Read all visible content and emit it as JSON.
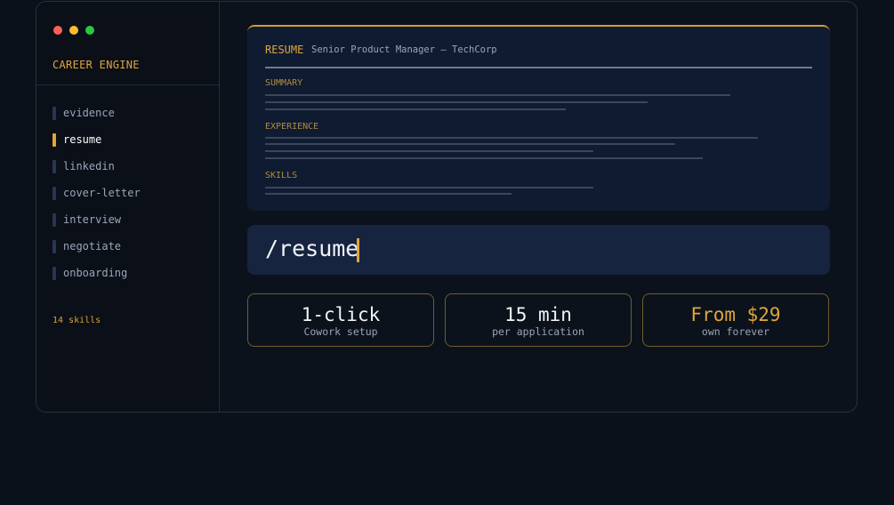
{
  "sidebar": {
    "brand": "CAREER ENGINE",
    "items": [
      {
        "label": "evidence",
        "active": false
      },
      {
        "label": "resume",
        "active": true
      },
      {
        "label": "linkedin",
        "active": false
      },
      {
        "label": "cover-letter",
        "active": false
      },
      {
        "label": "interview",
        "active": false
      },
      {
        "label": "negotiate",
        "active": false
      },
      {
        "label": "onboarding",
        "active": false
      }
    ],
    "skill_count": "14 skills"
  },
  "window_controls": {
    "close_color": "#ff5f57",
    "minimize_color": "#febc2e",
    "maximize_color": "#28c840"
  },
  "resume": {
    "title": "RESUME",
    "subtitle": "Senior Product Manager — TechCorp",
    "sections": {
      "summary": "SUMMARY",
      "experience": "EXPERIENCE",
      "skills": "SKILLS"
    }
  },
  "command": {
    "text": "/resume"
  },
  "stats": [
    {
      "value": "1-click",
      "caption": "Cowork setup",
      "highlight": false
    },
    {
      "value": "15 min",
      "caption": "per application",
      "highlight": false
    },
    {
      "value": "From $29",
      "caption": "own forever",
      "highlight": true
    }
  ],
  "colors": {
    "accent": "#e0a53a",
    "background": "#0b111b",
    "panel": "#0f1b30"
  }
}
